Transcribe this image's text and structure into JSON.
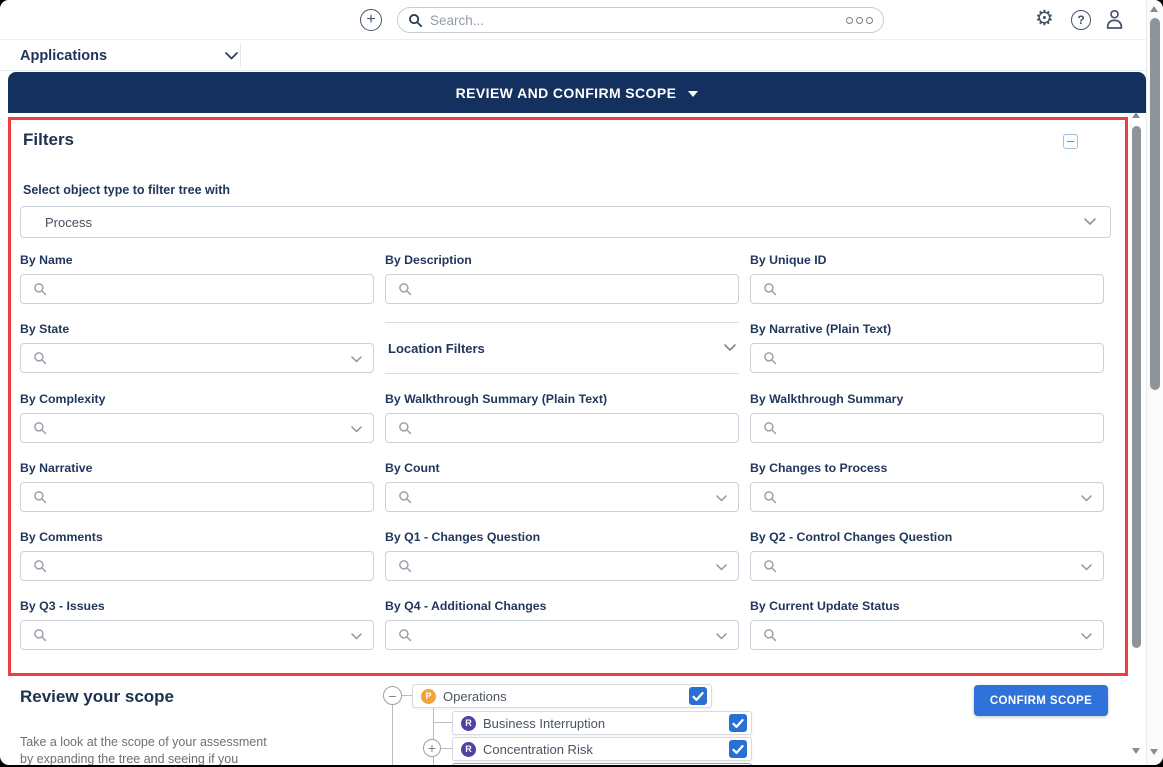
{
  "topbar": {
    "search_placeholder": "Search...",
    "create_icon": "plus-circle-icon",
    "more_icon": "kebab-ooo-icon",
    "settings_icon": "gear-icon",
    "help_icon": "help-icon",
    "user_icon": "user-icon"
  },
  "nav": {
    "app_selector_label": "Applications"
  },
  "banner": {
    "title": "REVIEW AND CONFIRM SCOPE"
  },
  "filters": {
    "title": "Filters",
    "object_type_label": "Select object type to filter tree with",
    "object_type_value": "Process",
    "fields": [
      {
        "label": "By Name",
        "type": "text"
      },
      {
        "label": "By Description",
        "type": "text"
      },
      {
        "label": "By Unique ID",
        "type": "text"
      },
      {
        "label": "By State",
        "type": "select"
      },
      {
        "label": "Location Filters",
        "type": "accordion"
      },
      {
        "label": "By Narrative (Plain Text)",
        "type": "text"
      },
      {
        "label": "By Complexity",
        "type": "select"
      },
      {
        "label": "By Walkthrough Summary (Plain Text)",
        "type": "text"
      },
      {
        "label": "By Walkthrough Summary",
        "type": "text"
      },
      {
        "label": "By Narrative",
        "type": "text"
      },
      {
        "label": "By Count",
        "type": "select"
      },
      {
        "label": "By Changes to Process",
        "type": "select"
      },
      {
        "label": "By Comments",
        "type": "text"
      },
      {
        "label": "By Q1 - Changes Question",
        "type": "select"
      },
      {
        "label": "By Q2 - Control Changes Question",
        "type": "select"
      },
      {
        "label": "By Q3 - Issues",
        "type": "select"
      },
      {
        "label": "By Q4 - Additional Changes",
        "type": "select"
      },
      {
        "label": "By Current Update Status",
        "type": "select"
      }
    ]
  },
  "scope": {
    "title": "Review your scope",
    "description_lines": [
      "Take a look at the scope of your assessment",
      "by expanding the tree and seeing if you"
    ],
    "confirm_button_label": "CONFIRM SCOPE",
    "tree": [
      {
        "label": "Operations",
        "badge_letter": "P",
        "badge_color": "#F2A33A",
        "checked": true,
        "expander": "minus"
      },
      {
        "label": "Business Interruption",
        "badge_letter": "R",
        "badge_color": "#5241A0",
        "checked": true,
        "expander": "none"
      },
      {
        "label": "Concentration Risk",
        "badge_letter": "R",
        "badge_color": "#5241A0",
        "checked": true,
        "expander": "plus"
      }
    ]
  },
  "colors": {
    "banner_bg": "#13305E",
    "highlight_red": "#EE3D41",
    "button_blue": "#2F72D9",
    "checkbox_blue": "#2A6FD4"
  }
}
